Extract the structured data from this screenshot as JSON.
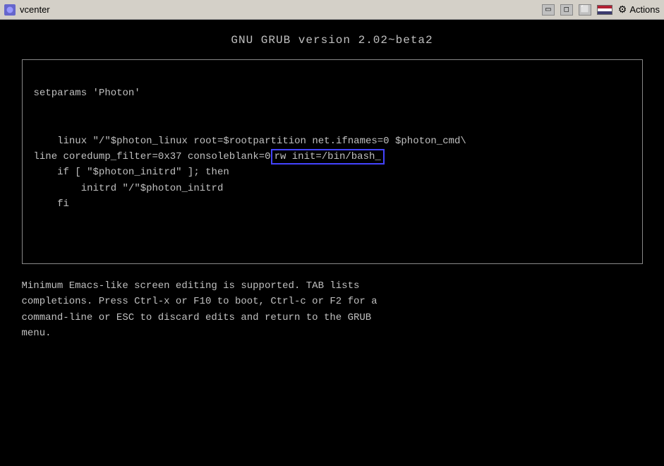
{
  "titlebar": {
    "title": "vcenter",
    "actions_label": "Actions"
  },
  "grub": {
    "header": "GNU GRUB  version 2.02~beta2",
    "editor": {
      "line1": "setparams 'Photon'",
      "line2": "",
      "line3": "    linux \"/\"$photon_linux root=$rootpartition net.ifnames=0 $photon_cmd\\",
      "line4_before": "line coredump_filter=0x37 consoleblank=0",
      "line4_highlight": "rw init=/bin/bash_",
      "line5": "    if [ \"$photon_initrd\" ]; then",
      "line6": "        initrd \"/\"$photon_initrd",
      "line7": "    fi"
    },
    "help_text": "Minimum Emacs-like screen editing is supported. TAB lists\ncompletions. Press Ctrl-x or F10 to boot, Ctrl-c or F2 for a\ncommand-line or ESC to discard edits and return to the GRUB\nmenu."
  }
}
